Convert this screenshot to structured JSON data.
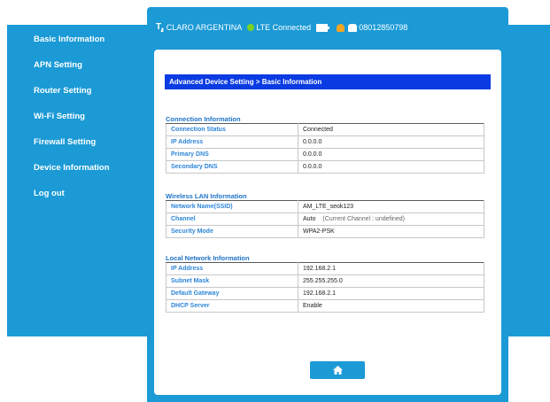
{
  "sidebar": {
    "items": [
      {
        "label": "Basic Information"
      },
      {
        "label": "APN Setting"
      },
      {
        "label": "Router Setting"
      },
      {
        "label": "Wi-Fi Setting"
      },
      {
        "label": "Firewall Setting"
      },
      {
        "label": "Device Information"
      },
      {
        "label": "Log out"
      }
    ]
  },
  "status": {
    "carrier": "CLARO ARGENTINA",
    "network": "LTE Connected",
    "phone": "08012850798",
    "icons": [
      "signal-icon",
      "connected-dot-icon",
      "battery-icon",
      "people-icon",
      "phone-icon"
    ]
  },
  "breadcrumb": "Advanced Device Setting > Basic Information",
  "connection": {
    "title": "Connection Information",
    "rows": [
      {
        "k": "Connection Status",
        "v": "Connected"
      },
      {
        "k": "IP Address",
        "v": "0.0.0.0"
      },
      {
        "k": "Primary DNS",
        "v": "0.0.0.0"
      },
      {
        "k": "Secondary DNS",
        "v": "0.0.0.0"
      }
    ]
  },
  "wireless": {
    "title": "Wireless LAN Information",
    "ssid_label": "Network Name(SSID)",
    "ssid": "AM_LTE_seok123",
    "channel_label": "Channel",
    "channel": "Auto",
    "channel_note": "(Current Channel : undefined)",
    "security_label": "Security Mode",
    "security": "WPA2-PSK"
  },
  "local": {
    "title": "Local Network Information",
    "rows": [
      {
        "k": "IP Address",
        "v": "192.168.2.1"
      },
      {
        "k": "Subnet Mask",
        "v": "255.255.255.0"
      },
      {
        "k": "Default Gateway",
        "v": "192.168.2.1"
      },
      {
        "k": "DHCP Server",
        "v": "Enable"
      }
    ]
  },
  "colors": {
    "brand_blue": "#1b9ad6",
    "breadcrumb_blue": "#0a3be3",
    "label_blue": "#2e86d9"
  }
}
